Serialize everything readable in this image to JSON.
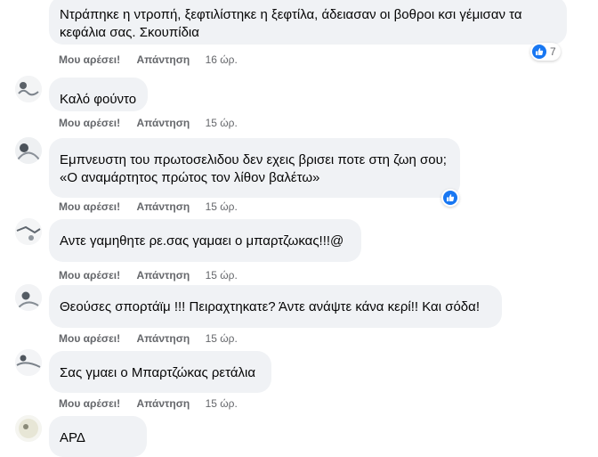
{
  "colors": {
    "bubble": "#f0f2f5",
    "action_text": "#65676b",
    "like_blue": "#1877f2",
    "text": "#050505"
  },
  "actions": {
    "like_label": "Μου αρέσει!",
    "reply_label": "Απάντηση"
  },
  "comments": [
    {
      "author": "",
      "lines": [
        "Ντράπηκε η ντροπή, ξεφτιλίστηκε η ξεφτίλα, άδειασαν οι βοθροι κσι γέμισαν τα",
        "κεφάλια σας. Σκουπίδια"
      ],
      "time": "16 ώρ.",
      "reactions": {
        "icon": "like-icon",
        "count": "7"
      }
    },
    {
      "author": "",
      "lines": [
        "Καλό φούντο"
      ],
      "time": "15 ώρ."
    },
    {
      "author": "",
      "lines": [
        "Εμπνευστη του πρωτοσελιδου δεν εχεις βρισει ποτε στη ζωη σου;",
        "«Ο αναμάρτητος πρώτος τον λίθον βαλέτω»"
      ],
      "time": "15 ώρ.",
      "reactions": {
        "icon": "like-icon",
        "count": ""
      }
    },
    {
      "author": "",
      "lines": [
        "Αντε γαμηθητε ρε.σας γαμαει ο μπαρτζωκας!!!@"
      ],
      "time": "15 ώρ."
    },
    {
      "author": "",
      "lines": [
        "Θεούσες σπορτάϊμ !!! Πειραχτηκατε? Άντε ανάψτε κάνα κερί!! Και σόδα!"
      ],
      "time": "15 ώρ."
    },
    {
      "author": "",
      "lines": [
        "Σας γμαει ο Μπαρτζώκας ρετάλια"
      ],
      "time": "15 ώρ."
    },
    {
      "author": "",
      "lines": [
        "ΑΡΔ"
      ]
    }
  ]
}
